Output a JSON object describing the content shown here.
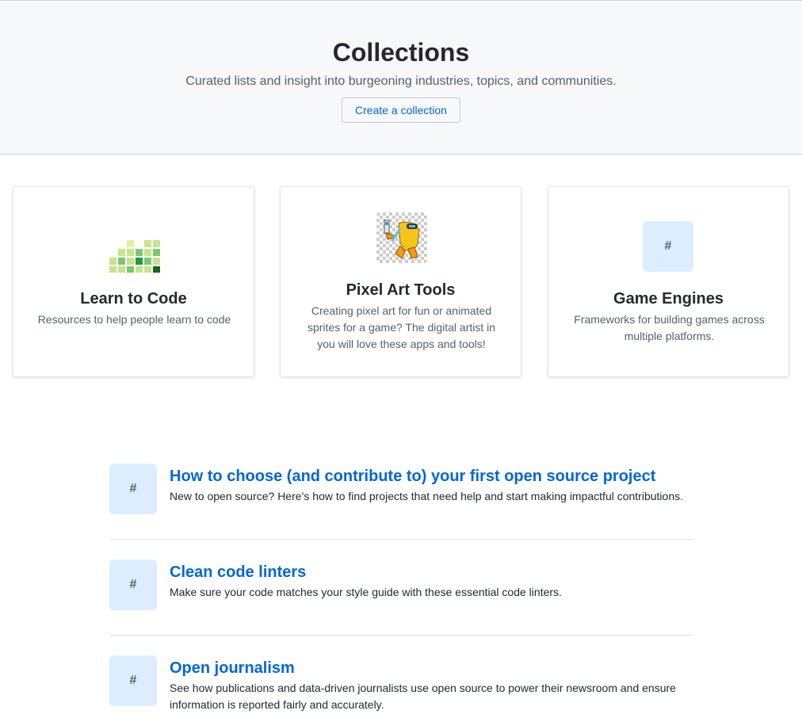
{
  "hero": {
    "title": "Collections",
    "subtitle": "Curated lists and insight into burgeoning industries, topics, and communities.",
    "button_label": "Create a collection"
  },
  "featured": [
    {
      "title": "Learn to Code",
      "description": "Resources to help people learn to code",
      "icon": "green-contribution-grid-icon"
    },
    {
      "title": "Pixel Art Tools",
      "description": "Creating pixel art for fun or animated sprites for a game? The digital artist in you will love these apps and tools!",
      "icon": "pixel-art-robot-icon"
    },
    {
      "title": "Game Engines",
      "description": "Frameworks for building games across multiple platforms.",
      "icon_text": "#"
    }
  ],
  "collections": [
    {
      "icon_text": "#",
      "title": "How to choose (and contribute to) your first open source project",
      "description": "New to open source? Here’s how to find projects that need help and start making impactful contributions."
    },
    {
      "icon_text": "#",
      "title": "Clean code linters",
      "description": "Make sure your code matches your style guide with these essential code linters."
    },
    {
      "icon_text": "#",
      "title": "Open journalism",
      "description": "See how publications and data-driven journalists use open source to power their newsroom and ensure information is reported fairly and accurately."
    }
  ],
  "colors": {
    "link": "#0366d6",
    "hero_bg": "#f6f8fa",
    "tile_bg": "#dbedff"
  }
}
